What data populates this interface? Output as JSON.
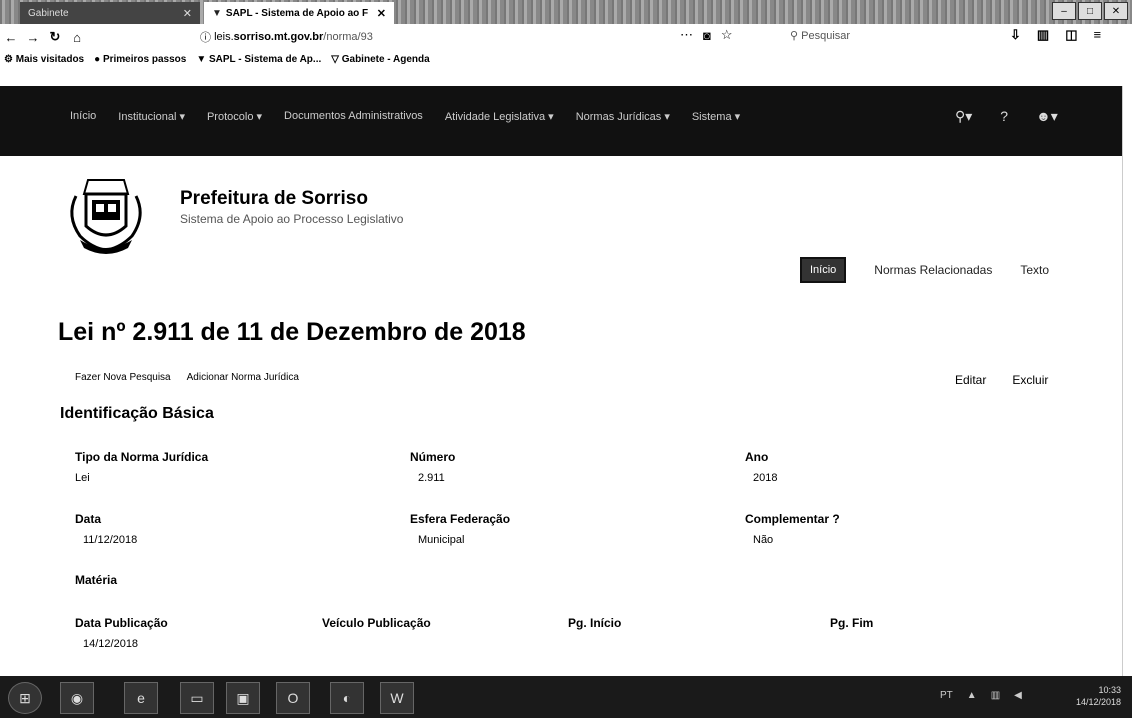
{
  "browser": {
    "tab_inactive": "Gabinete",
    "tab_active": "SAPL - Sistema de Apoio ao F",
    "url_prefix": "leis.",
    "url_domain": "sorriso.mt.gov.br",
    "url_path": "/norma/93",
    "search_placeholder": "Pesquisar",
    "bookmarks": [
      "Mais visitados",
      "Primeiros passos",
      "SAPL - Sistema de Ap...",
      "Gabinete - Agenda"
    ]
  },
  "nav": {
    "items": [
      "Início",
      "Institucional ▾",
      "Protocolo ▾",
      "Documentos Administrativos",
      "Atividade Legislativa ▾",
      "Normas Jurídicas ▾",
      "Sistema ▾"
    ]
  },
  "header": {
    "title": "Prefeitura de Sorriso",
    "subtitle": "Sistema de Apoio ao Processo Legislativo"
  },
  "norma_tabs": [
    "Início",
    "Normas Relacionadas",
    "Texto"
  ],
  "page_title": "Lei nº 2.911 de 11 de Dezembro de 2018",
  "actions": {
    "new_search": "Fazer Nova Pesquisa",
    "add_norma": "Adicionar Norma Jurídica",
    "edit": "Editar",
    "delete": "Excluir"
  },
  "section_title": "Identificação Básica",
  "fields": {
    "tipo": {
      "label": "Tipo da Norma Jurídica",
      "value": "Lei"
    },
    "numero": {
      "label": "Número",
      "value": "2.911"
    },
    "ano": {
      "label": "Ano",
      "value": "2018"
    },
    "data": {
      "label": "Data",
      "value": "11/12/2018"
    },
    "esfera": {
      "label": "Esfera Federação",
      "value": "Municipal"
    },
    "complementar": {
      "label": "Complementar ?",
      "value": "Não"
    },
    "materia": {
      "label": "Matéria"
    },
    "data_pub": {
      "label": "Data Publicação",
      "value": "14/12/2018"
    },
    "veiculo": {
      "label": "Veículo Publicação"
    },
    "pg_inicio": {
      "label": "Pg. Início"
    },
    "pg_fim": {
      "label": "Pg. Fim"
    }
  },
  "taskbar": {
    "time": "10:33",
    "date": "14/12/2018"
  }
}
